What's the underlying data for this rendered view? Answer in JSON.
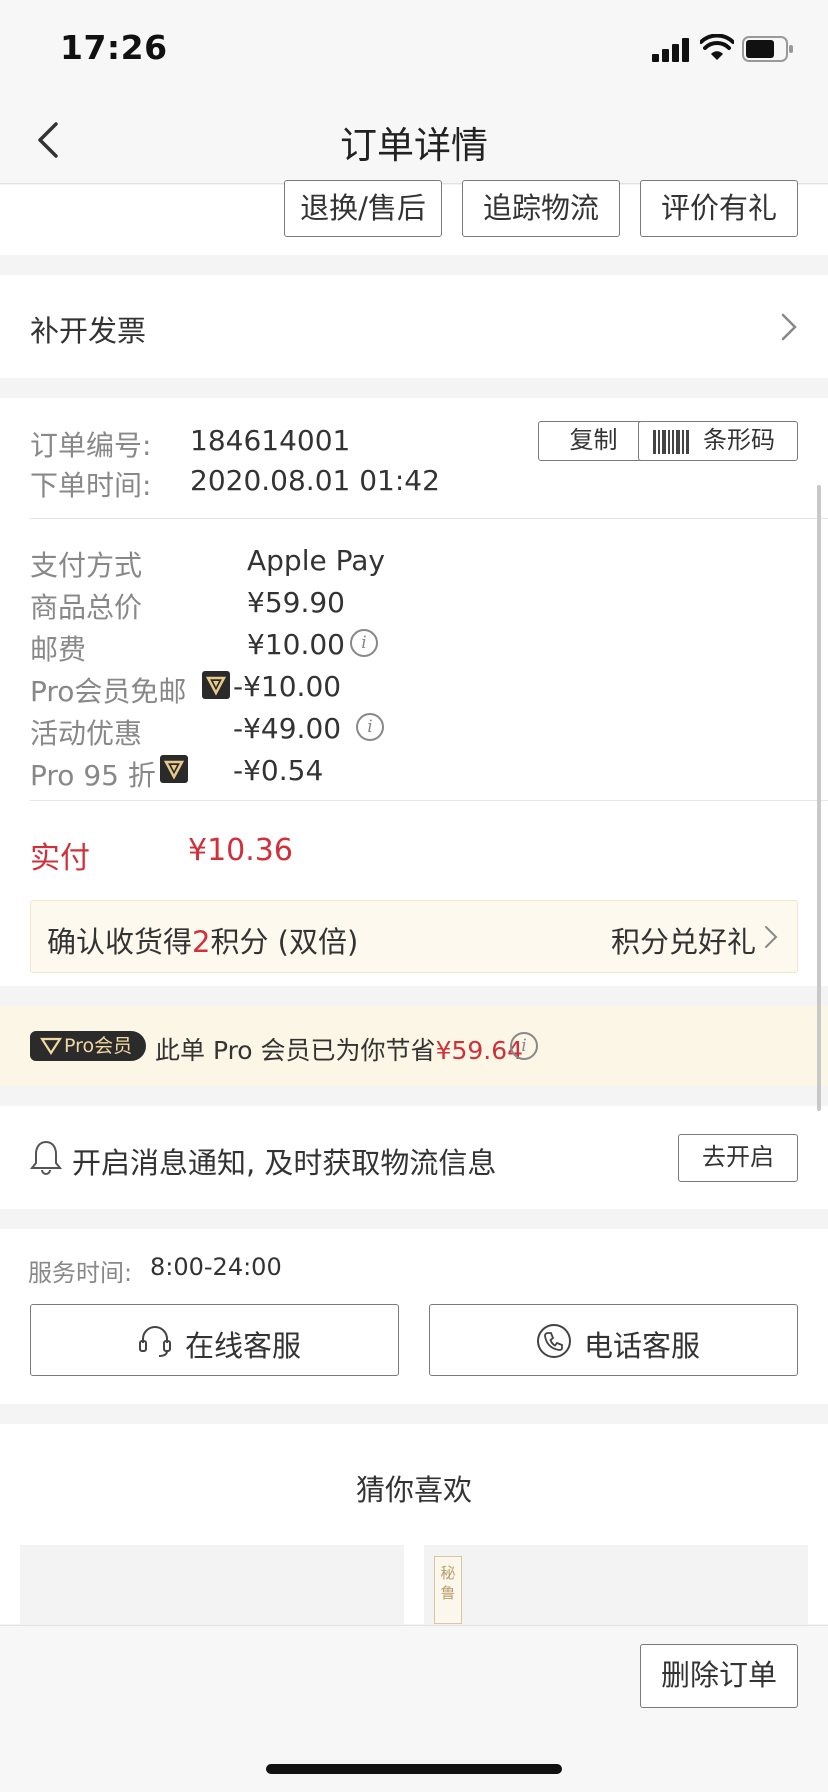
{
  "status_bar": {
    "time": "17:26"
  },
  "nav": {
    "title": "订单详情"
  },
  "actions": {
    "return_label": "退换/售后",
    "track_label": "追踪物流",
    "review_label": "评价有礼"
  },
  "invoice": {
    "label": "补开发票"
  },
  "order": {
    "number_label": "订单编号:",
    "number_value": "184614001",
    "time_label": "下单时间:",
    "time_value": "2020.08.01 01:42",
    "copy_label": "复制",
    "barcode_label": "条形码"
  },
  "payment": {
    "method_label": "支付方式",
    "method_value": "Apple Pay",
    "total_label": "商品总价",
    "total_value": "¥59.90",
    "shipping_label": "邮费",
    "shipping_value": "¥10.00",
    "pro_free_label": "Pro会员免邮",
    "pro_free_value": "-¥10.00",
    "promo_label": "活动优惠",
    "promo_value": "-¥49.00",
    "pro_discount_label": "Pro 95 折",
    "pro_discount_value": "-¥0.54",
    "paid_label": "实付",
    "paid_value": "¥10.36"
  },
  "points": {
    "prefix": "确认收货得",
    "count": "2",
    "suffix": "积分 (双倍)",
    "link": "积分兑好礼"
  },
  "pro_saving": {
    "tag": "Pro会员",
    "text": "此单 Pro 会员已为你节省",
    "amount": "¥59.64"
  },
  "notify": {
    "text": "开启消息通知, 及时获取物流信息",
    "button": "去开启"
  },
  "service": {
    "time_label": "服务时间:",
    "time_value": "8:00-24:00",
    "online_label": "在线客服",
    "phone_label": "电话客服"
  },
  "recommend": {
    "title": "猜你喜欢",
    "tag": "秘鲁"
  },
  "bottom": {
    "delete_label": "删除订单"
  },
  "colors": {
    "accent_red": "#d0303a",
    "pro_gold": "#f2d8a2",
    "pro_bg": "#fcf6e7"
  }
}
